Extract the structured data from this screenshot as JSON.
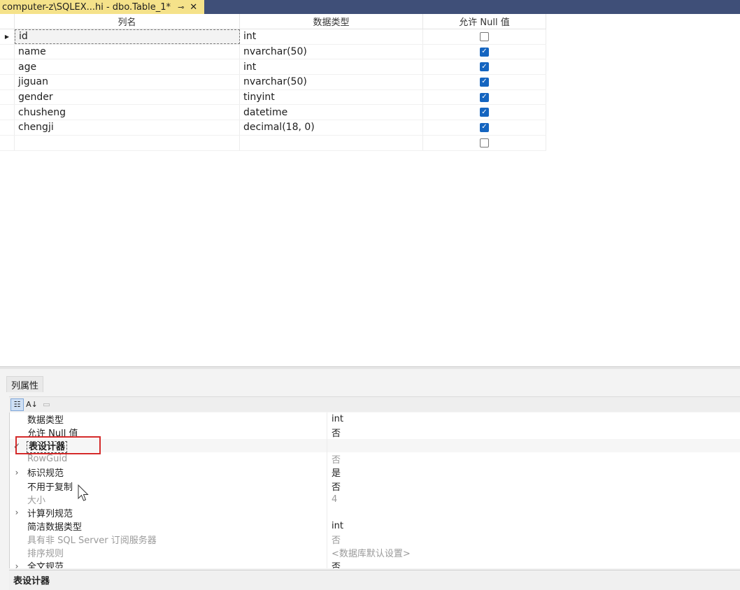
{
  "tab": {
    "title": "computer-z\\SQLEX...hi - dbo.Table_1*",
    "pin": "⊸",
    "close": "✕"
  },
  "grid": {
    "headers": [
      "列名",
      "数据类型",
      "允许 Null 值"
    ],
    "rows": [
      {
        "name": "id",
        "type": "int",
        "allow_null": false,
        "selected": true
      },
      {
        "name": "name",
        "type": "nvarchar(50)",
        "allow_null": true
      },
      {
        "name": "age",
        "type": "int",
        "allow_null": true
      },
      {
        "name": "jiguan",
        "type": "nvarchar(50)",
        "allow_null": true
      },
      {
        "name": "gender",
        "type": "tinyint",
        "allow_null": true
      },
      {
        "name": "chusheng",
        "type": "datetime",
        "allow_null": true
      },
      {
        "name": "chengji",
        "type": "decimal(18, 0)",
        "allow_null": true
      },
      {
        "name": "",
        "type": "",
        "allow_null": false
      }
    ]
  },
  "props": {
    "tab_label": "列属性",
    "rows": [
      {
        "name": "数据类型",
        "value": "int",
        "kind": "normal",
        "exp": ""
      },
      {
        "name": "允许 Null 值",
        "value": "否",
        "kind": "normal",
        "exp": ""
      },
      {
        "name": "表设计器",
        "value": "",
        "kind": "cat",
        "exp": "✓"
      },
      {
        "name": "RowGuid",
        "value": "否",
        "kind": "dis",
        "exp": ""
      },
      {
        "name": "标识规范",
        "value": "是",
        "kind": "normal",
        "exp": "›"
      },
      {
        "name": "不用于复制",
        "value": "否",
        "kind": "normal",
        "exp": ""
      },
      {
        "name": "大小",
        "value": "4",
        "kind": "dis",
        "exp": ""
      },
      {
        "name": "计算列规范",
        "value": "",
        "kind": "normal",
        "exp": "›"
      },
      {
        "name": "简洁数据类型",
        "value": "int",
        "kind": "normal",
        "exp": ""
      },
      {
        "name": "具有非 SQL Server 订阅服务器",
        "value": "否",
        "kind": "dis",
        "exp": ""
      },
      {
        "name": "排序规则",
        "value": "<数据库默认设置>",
        "kind": "dis",
        "exp": ""
      },
      {
        "name": "全文规范",
        "value": "否",
        "kind": "normal",
        "exp": "›"
      }
    ],
    "description": "表设计器"
  }
}
